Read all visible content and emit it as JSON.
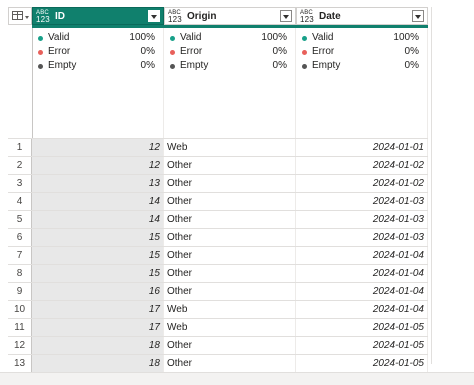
{
  "colors": {
    "selected_header": "#10806d",
    "valid": "#18a089",
    "error": "#e8605b",
    "empty": "#555555"
  },
  "columns": [
    {
      "type_top": "ABC",
      "type_bottom": "123",
      "name": "ID",
      "selected": true
    },
    {
      "type_top": "ABC",
      "type_bottom": "123",
      "name": "Origin",
      "selected": false
    },
    {
      "type_top": "ABC",
      "type_bottom": "123",
      "name": "Date",
      "selected": false
    }
  ],
  "quality": [
    {
      "valid_label": "Valid",
      "valid_pct": "100%",
      "error_label": "Error",
      "error_pct": "0%",
      "empty_label": "Empty",
      "empty_pct": "0%"
    },
    {
      "valid_label": "Valid",
      "valid_pct": "100%",
      "error_label": "Error",
      "error_pct": "0%",
      "empty_label": "Empty",
      "empty_pct": "0%"
    },
    {
      "valid_label": "Valid",
      "valid_pct": "100%",
      "error_label": "Error",
      "error_pct": "0%",
      "empty_label": "Empty",
      "empty_pct": "0%"
    }
  ],
  "rows": [
    {
      "n": "1",
      "id": "12",
      "origin": "Web",
      "date": "2024-01-01"
    },
    {
      "n": "2",
      "id": "12",
      "origin": "Other",
      "date": "2024-01-02"
    },
    {
      "n": "3",
      "id": "13",
      "origin": "Other",
      "date": "2024-01-02"
    },
    {
      "n": "4",
      "id": "14",
      "origin": "Other",
      "date": "2024-01-03"
    },
    {
      "n": "5",
      "id": "14",
      "origin": "Other",
      "date": "2024-01-03"
    },
    {
      "n": "6",
      "id": "15",
      "origin": "Other",
      "date": "2024-01-03"
    },
    {
      "n": "7",
      "id": "15",
      "origin": "Other",
      "date": "2024-01-04"
    },
    {
      "n": "8",
      "id": "15",
      "origin": "Other",
      "date": "2024-01-04"
    },
    {
      "n": "9",
      "id": "16",
      "origin": "Other",
      "date": "2024-01-04"
    },
    {
      "n": "10",
      "id": "17",
      "origin": "Web",
      "date": "2024-01-04"
    },
    {
      "n": "11",
      "id": "17",
      "origin": "Web",
      "date": "2024-01-05"
    },
    {
      "n": "12",
      "id": "18",
      "origin": "Other",
      "date": "2024-01-05"
    },
    {
      "n": "13",
      "id": "18",
      "origin": "Other",
      "date": "2024-01-05"
    }
  ]
}
